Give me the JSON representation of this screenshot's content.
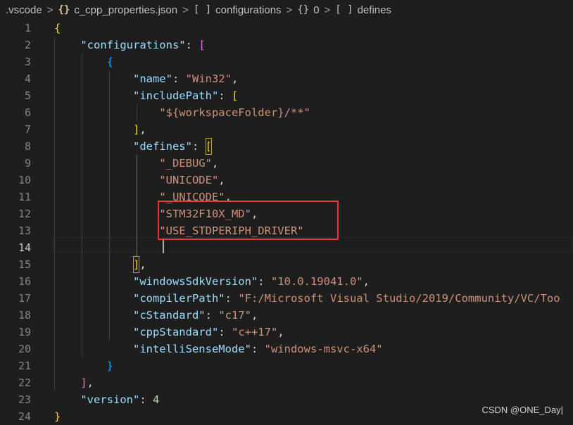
{
  "breadcrumb": {
    "items": [
      {
        "label": ".vscode",
        "icon": ""
      },
      {
        "label": "c_cpp_properties.json",
        "icon": "{}"
      },
      {
        "label": "configurations",
        "icon": "[ ]"
      },
      {
        "label": "0",
        "icon": "{}"
      },
      {
        "label": "defines",
        "icon": "[ ]"
      }
    ],
    "separator": ">"
  },
  "editor": {
    "active_line": 14,
    "line_numbers": [
      "1",
      "2",
      "3",
      "4",
      "5",
      "6",
      "7",
      "8",
      "9",
      "10",
      "11",
      "12",
      "13",
      "14",
      "15",
      "16",
      "17",
      "18",
      "19",
      "20",
      "21",
      "22",
      "23",
      "24"
    ],
    "lines": [
      [
        {
          "t": "{",
          "c": "b1"
        }
      ],
      [
        {
          "t": "    "
        },
        {
          "t": "\"configurations\"",
          "c": "k"
        },
        {
          "t": ": ",
          "c": "p"
        },
        {
          "t": "[",
          "c": "b2"
        }
      ],
      [
        {
          "t": "        "
        },
        {
          "t": "{",
          "c": "b3"
        }
      ],
      [
        {
          "t": "            "
        },
        {
          "t": "\"name\"",
          "c": "k"
        },
        {
          "t": ": ",
          "c": "p"
        },
        {
          "t": "\"Win32\"",
          "c": "s"
        },
        {
          "t": ",",
          "c": "p"
        }
      ],
      [
        {
          "t": "            "
        },
        {
          "t": "\"includePath\"",
          "c": "k"
        },
        {
          "t": ": ",
          "c": "p"
        },
        {
          "t": "[",
          "c": "b1"
        }
      ],
      [
        {
          "t": "                "
        },
        {
          "t": "\"${workspaceFolder}/**\"",
          "c": "s"
        }
      ],
      [
        {
          "t": "            "
        },
        {
          "t": "]",
          "c": "b1"
        },
        {
          "t": ",",
          "c": "p"
        }
      ],
      [
        {
          "t": "            "
        },
        {
          "t": "\"defines\"",
          "c": "k"
        },
        {
          "t": ": ",
          "c": "p"
        },
        {
          "t": "[",
          "c": "b1",
          "m": true
        }
      ],
      [
        {
          "t": "                "
        },
        {
          "t": "\"_DEBUG\"",
          "c": "s"
        },
        {
          "t": ",",
          "c": "p"
        }
      ],
      [
        {
          "t": "                "
        },
        {
          "t": "\"UNICODE\"",
          "c": "s"
        },
        {
          "t": ",",
          "c": "p"
        }
      ],
      [
        {
          "t": "                "
        },
        {
          "t": "\"_UNICODE\"",
          "c": "s"
        },
        {
          "t": ",",
          "c": "p"
        }
      ],
      [
        {
          "t": "                "
        },
        {
          "t": "\"STM32F10X_MD\"",
          "c": "s"
        },
        {
          "t": ",",
          "c": "p"
        }
      ],
      [
        {
          "t": "                "
        },
        {
          "t": "\"USE_STDPERIPH_DRIVER\"",
          "c": "s"
        }
      ],
      [
        {
          "t": ""
        }
      ],
      [
        {
          "t": "            "
        },
        {
          "t": "]",
          "c": "b1",
          "m": true
        },
        {
          "t": ",",
          "c": "p"
        }
      ],
      [
        {
          "t": "            "
        },
        {
          "t": "\"windowsSdkVersion\"",
          "c": "k"
        },
        {
          "t": ": ",
          "c": "p"
        },
        {
          "t": "\"10.0.19041.0\"",
          "c": "s"
        },
        {
          "t": ",",
          "c": "p"
        }
      ],
      [
        {
          "t": "            "
        },
        {
          "t": "\"compilerPath\"",
          "c": "k"
        },
        {
          "t": ": ",
          "c": "p"
        },
        {
          "t": "\"F:/Microsoft Visual Studio/2019/Community/VC/Too",
          "c": "s"
        }
      ],
      [
        {
          "t": "            "
        },
        {
          "t": "\"cStandard\"",
          "c": "k"
        },
        {
          "t": ": ",
          "c": "p"
        },
        {
          "t": "\"c17\"",
          "c": "s"
        },
        {
          "t": ",",
          "c": "p"
        }
      ],
      [
        {
          "t": "            "
        },
        {
          "t": "\"cppStandard\"",
          "c": "k"
        },
        {
          "t": ": ",
          "c": "p"
        },
        {
          "t": "\"c++17\"",
          "c": "s"
        },
        {
          "t": ",",
          "c": "p"
        }
      ],
      [
        {
          "t": "            "
        },
        {
          "t": "\"intelliSenseMode\"",
          "c": "k"
        },
        {
          "t": ": ",
          "c": "p"
        },
        {
          "t": "\"windows-msvc-x64\"",
          "c": "s"
        }
      ],
      [
        {
          "t": "        "
        },
        {
          "t": "}",
          "c": "b3"
        }
      ],
      [
        {
          "t": "    "
        },
        {
          "t": "]",
          "c": "b2"
        },
        {
          "t": ",",
          "c": "p"
        }
      ],
      [
        {
          "t": "    "
        },
        {
          "t": "\"version\"",
          "c": "k"
        },
        {
          "t": ": ",
          "c": "p"
        },
        {
          "t": "4",
          "c": "n"
        }
      ],
      [
        {
          "t": "}",
          "c": "b1"
        }
      ]
    ]
  },
  "colors": {
    "background": "#1e1e1e",
    "key": "#9cdcfe",
    "string": "#ce9178",
    "number": "#b5cea8",
    "bracket_gold": "#ffd700",
    "bracket_purple": "#da70d6",
    "bracket_blue": "#179fff",
    "annotation_box": "#e03a3a"
  },
  "watermark": {
    "text": "CSDN @ONE_Day|"
  }
}
